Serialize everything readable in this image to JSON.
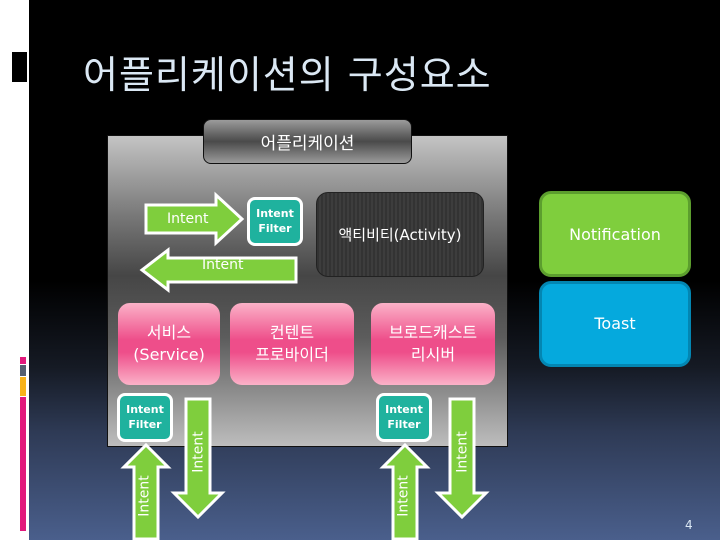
{
  "slide": {
    "title": "어플리케이션의 구성요소",
    "page_number": "4"
  },
  "diagram": {
    "application_label": "어플리케이션",
    "activity_label": "액티비티(Activity)",
    "intent_label": "Intent",
    "intent_filter": {
      "line1": "Intent",
      "line2": "Filter"
    },
    "service": {
      "line1": "서비스",
      "line2": "(Service)"
    },
    "content_provider": {
      "line1": "컨텐트",
      "line2": "프로바이더"
    },
    "broadcast_receiver": {
      "line1": "브로드캐스트",
      "line2": "리시버"
    },
    "notification_label": "Notification",
    "toast_label": "Toast"
  },
  "colors": {
    "arrow_green": "#7fce3d",
    "filter_teal": "#1fb29e",
    "component_pink": "#ee4e8a",
    "notification_green": "#7fce3d",
    "toast_blue": "#05a9dd",
    "title_text": "#dbe8f4"
  }
}
